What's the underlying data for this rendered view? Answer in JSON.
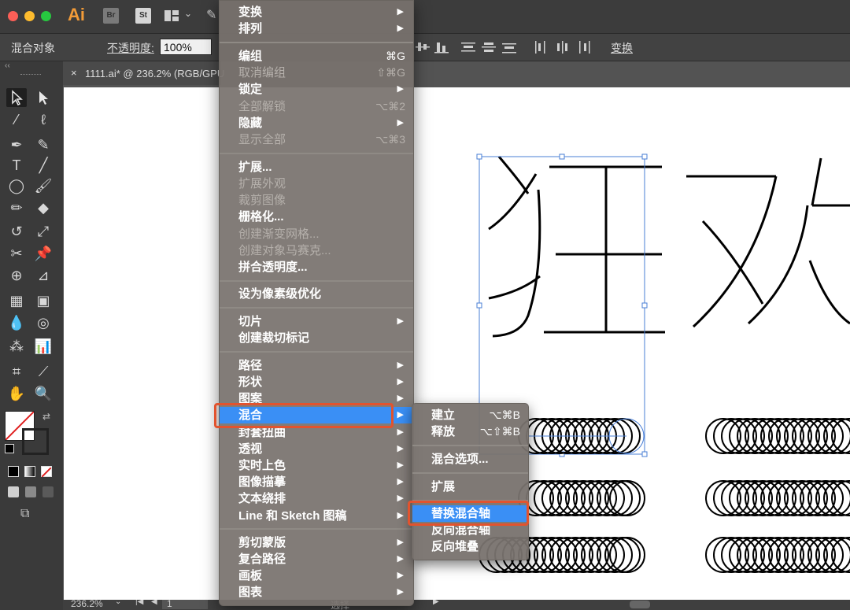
{
  "app": {
    "logo": "Ai",
    "bridge": "Br",
    "stock": "St"
  },
  "control_bar": {
    "selection_label": "混合对象",
    "opacity_label": "不透明度:",
    "opacity_value": "100%",
    "transform_label": "变换"
  },
  "document": {
    "tab_title": "1111.ai* @ 236.2% (RGB/GPU"
  },
  "canvas": {
    "text": "狂欢"
  },
  "status": {
    "zoom": "236.2%",
    "artboard": "1",
    "mode": "选择"
  },
  "menu": {
    "items": [
      {
        "label": "变换",
        "submenu": true
      },
      {
        "label": "排列",
        "submenu": true
      },
      {
        "label": "编组",
        "shortcut": "⌘G"
      },
      {
        "label": "取消编组",
        "shortcut": "⇧⌘G",
        "disabled": true
      },
      {
        "label": "锁定",
        "submenu": true
      },
      {
        "label": "全部解锁",
        "shortcut": "⌥⌘2",
        "disabled": true
      },
      {
        "label": "隐藏",
        "submenu": true
      },
      {
        "label": "显示全部",
        "shortcut": "⌥⌘3",
        "disabled": true
      },
      {
        "label": "扩展..."
      },
      {
        "label": "扩展外观",
        "disabled": true
      },
      {
        "label": "裁剪图像",
        "disabled": true
      },
      {
        "label": "栅格化..."
      },
      {
        "label": "创建渐变网格...",
        "disabled": true
      },
      {
        "label": "创建对象马赛克...",
        "disabled": true
      },
      {
        "label": "拼合透明度..."
      },
      {
        "label": "设为像素级优化"
      },
      {
        "label": "切片",
        "submenu": true
      },
      {
        "label": "创建裁切标记"
      },
      {
        "label": "路径",
        "submenu": true
      },
      {
        "label": "形状",
        "submenu": true
      },
      {
        "label": "图案",
        "submenu": true
      },
      {
        "label": "混合",
        "submenu": true,
        "highlighted": true
      },
      {
        "label": "封套扭曲",
        "submenu": true
      },
      {
        "label": "透视",
        "submenu": true
      },
      {
        "label": "实时上色",
        "submenu": true
      },
      {
        "label": "图像描摹",
        "submenu": true
      },
      {
        "label": "文本绕排",
        "submenu": true
      },
      {
        "label": "Line 和 Sketch 图稿",
        "submenu": true
      },
      {
        "label": "剪切蒙版",
        "submenu": true
      },
      {
        "label": "复合路径",
        "submenu": true
      },
      {
        "label": "画板",
        "submenu": true
      },
      {
        "label": "图表",
        "submenu": true
      }
    ]
  },
  "blend_submenu": {
    "items": [
      {
        "label": "建立",
        "shortcut": "⌥⌘B"
      },
      {
        "label": "释放",
        "shortcut": "⌥⇧⌘B"
      },
      {
        "label": "混合选项..."
      },
      {
        "label": "扩展"
      },
      {
        "label": "替换混合轴",
        "highlighted": true
      },
      {
        "label": "反向混合轴"
      },
      {
        "label": "反向堆叠"
      }
    ]
  },
  "colors": {
    "menu_highlight": "#3a8ff5",
    "annotation_box": "#e2532e",
    "selection": "#4a7fd6"
  }
}
